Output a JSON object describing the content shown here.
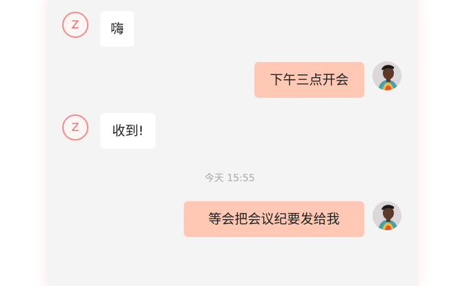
{
  "messages": [
    {
      "sender": "Z",
      "direction": "incoming",
      "text": "嗨"
    },
    {
      "direction": "outgoing",
      "text": "下午三点开会"
    },
    {
      "sender": "Z",
      "direction": "incoming",
      "text": "收到!"
    },
    {
      "direction": "outgoing",
      "text": "等会把会议纪要发给我"
    }
  ],
  "timestamp": "今天 15:55",
  "colors": {
    "panel_background": "#f4f4f4",
    "incoming_bubble": "#ffffff",
    "outgoing_bubble": "#ffc8b4",
    "avatar_accent": "#ef6b6b"
  }
}
